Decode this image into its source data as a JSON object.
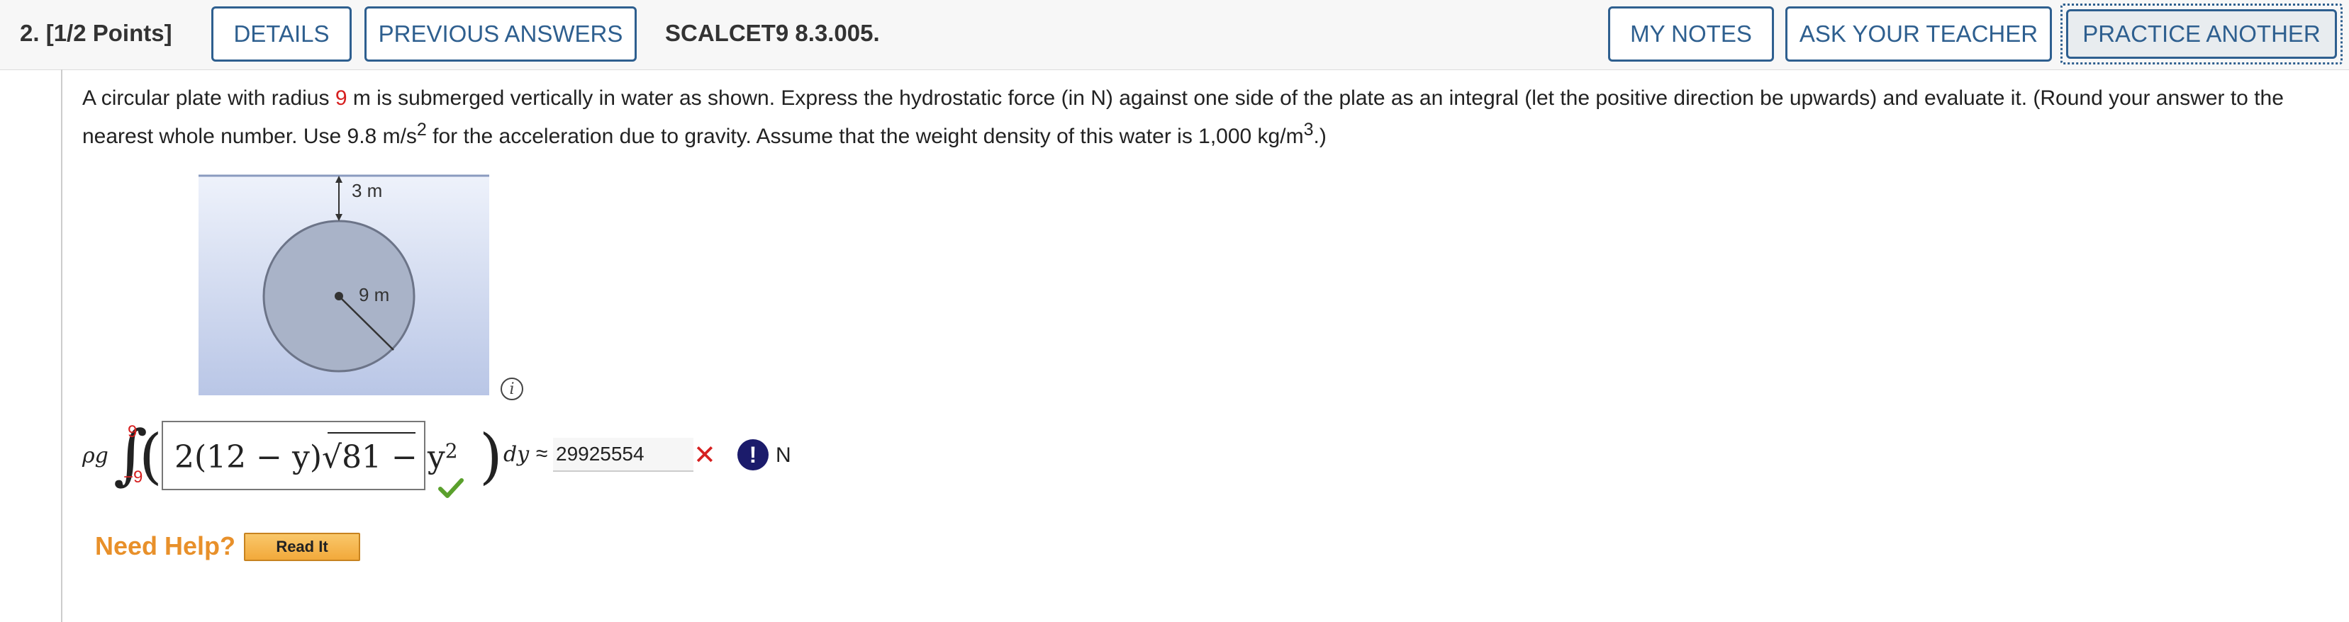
{
  "header": {
    "question_number": "2.",
    "points": "[1/2 Points]",
    "details_label": "DETAILS",
    "previous_answers_label": "PREVIOUS ANSWERS",
    "assignment_id": "SCALCET9 8.3.005.",
    "my_notes_label": "MY NOTES",
    "ask_teacher_label": "ASK YOUR TEACHER",
    "practice_another_label": "PRACTICE ANOTHER"
  },
  "question": {
    "text_a": "A circular plate with radius ",
    "radius": "9",
    "text_b": " m is submerged vertically in water as shown. Express the hydrostatic force (in N) against one side of the plate as an integral (let the positive direction be upwards) and evaluate it. (Round your answer to the nearest whole number. Use 9.8 m/s",
    "exp_a": "2",
    "text_c": " for the acceleration due to gravity. Assume that the weight density of this water is 1,000 kg/m",
    "exp_b": "3",
    "text_d": ".)"
  },
  "figure": {
    "depth_label": "3 m",
    "radius_label": "9 m",
    "water_color": "#c9d3ec",
    "plate_color": "#a9b3c8"
  },
  "integral": {
    "prefix": "ρg",
    "upper_limit": "9",
    "lower_limit": "−9",
    "integrand_a": "2(12 − y)√",
    "integrand_b": "81 − y",
    "integrand_exp": "2",
    "differential": "dy",
    "approx_symbol": "≈",
    "answer_value": "29925554",
    "unit": "N",
    "integrand_status": "correct",
    "answer_status": "incorrect"
  },
  "help": {
    "need_help_label": "Need Help?",
    "read_it_label": "Read It"
  },
  "colors": {
    "accent": "#2e5f8f",
    "error": "#d62020",
    "success": "#5aa02c",
    "help": "#e8902a"
  }
}
